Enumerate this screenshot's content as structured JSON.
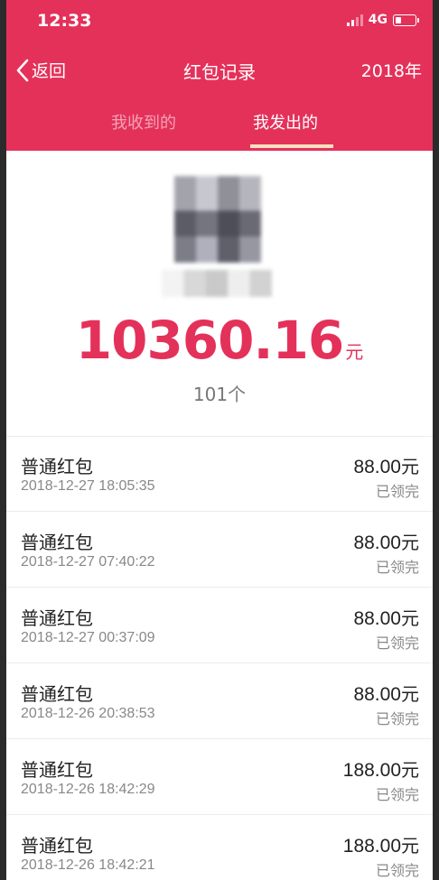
{
  "status_bar": {
    "time": "12:33",
    "network": "4G"
  },
  "nav": {
    "back_label": "返回",
    "title": "红包记录",
    "year": "2018年"
  },
  "tabs": [
    {
      "label": "我收到的",
      "active": false
    },
    {
      "label": "我发出的",
      "active": true
    }
  ],
  "summary": {
    "amount": "10360.16",
    "amount_unit": "元",
    "count": "101个"
  },
  "colors": {
    "accent": "#e4315a",
    "tab_underline": "#fbe0c0"
  },
  "records": [
    {
      "type": "普通红包",
      "time": "2018-12-27 18:05:35",
      "amount": "88.00",
      "unit": "元",
      "status": "已领完"
    },
    {
      "type": "普通红包",
      "time": "2018-12-27 07:40:22",
      "amount": "88.00",
      "unit": "元",
      "status": "已领完"
    },
    {
      "type": "普通红包",
      "time": "2018-12-27 00:37:09",
      "amount": "88.00",
      "unit": "元",
      "status": "已领完"
    },
    {
      "type": "普通红包",
      "time": "2018-12-26 20:38:53",
      "amount": "88.00",
      "unit": "元",
      "status": "已领完"
    },
    {
      "type": "普通红包",
      "time": "2018-12-26 18:42:29",
      "amount": "188.00",
      "unit": "元",
      "status": "已领完"
    },
    {
      "type": "普通红包",
      "time": "2018-12-26 18:42:21",
      "amount": "188.00",
      "unit": "元",
      "status": "已领完"
    }
  ]
}
